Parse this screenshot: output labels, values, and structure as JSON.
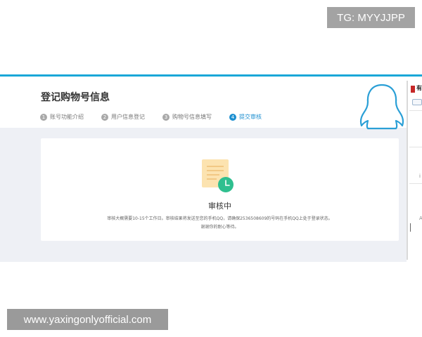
{
  "watermarks": {
    "top": "TG: MYYJJPP",
    "bottom": "www.yaxingonlyofficial.com"
  },
  "header": {
    "title": "登记购物号信息"
  },
  "steps": [
    {
      "num": "1",
      "label": "账号功能介绍"
    },
    {
      "num": "2",
      "label": "用户信息登记"
    },
    {
      "num": "3",
      "label": "购物号信息填写"
    },
    {
      "num": "4",
      "label": "提交审核"
    }
  ],
  "status": {
    "title": "审核中",
    "line1": "审核大概需要10-15个工作日。审核结果将发送至您的手机QQ，请确保2536508609的号码在手机QQ上处于登录状态。",
    "line2": "谢谢你的耐心等待。"
  },
  "side_panel": {
    "title": "有",
    "mark1": "i",
    "mark2": "A"
  },
  "colors": {
    "accent": "#1d8fd0",
    "topline": "#1aa7d8",
    "content_bg": "#eef0f5",
    "doc_icon": "#fce3b0",
    "clock_icon": "#2fbf8f"
  },
  "icons": [
    "document-clock-icon",
    "qq-penguin-icon"
  ]
}
